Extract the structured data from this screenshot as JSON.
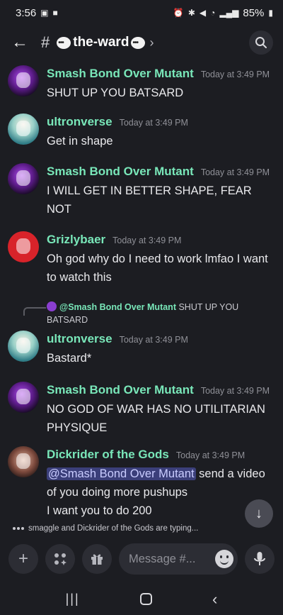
{
  "status_bar": {
    "time": "3:56",
    "battery": "85%"
  },
  "header": {
    "hash": "#",
    "channel_name": "the-ward"
  },
  "messages": [
    {
      "author": "Smash Bond Over Mutant",
      "time": "Today at 3:49 PM",
      "text": "SHUT UP YOU BATSARD"
    },
    {
      "author": "ultronverse",
      "time": "Today at 3:49 PM",
      "text": "Get in shape"
    },
    {
      "author": "Smash Bond Over Mutant",
      "time": "Today at 3:49 PM",
      "text": "I WILL GET IN BETTER SHAPE, FEAR NOT"
    },
    {
      "author": "Grizlybaer",
      "time": "Today at 3:49 PM",
      "text": "Oh god why do I need to work lmfao I want to watch this"
    },
    {
      "author": "ultronverse",
      "time": "Today at 3:49 PM",
      "text": "Bastard*"
    },
    {
      "author": "Smash Bond Over Mutant",
      "time": "Today at 3:49 PM",
      "text": "NO GOD OF WAR HAS NO UTILITARIAN PHYSIQUE"
    },
    {
      "author": "Dickrider of the Gods",
      "time": "Today at 3:49 PM",
      "mention": "@Smash Bond Over Mutant",
      "text": " send a video of you doing more pushups",
      "text2": "I want you to do 200"
    }
  ],
  "reply_ref": {
    "name": "@Smash Bond Over Mutant",
    "text": " SHUT UP YOU BATSARD"
  },
  "typing": "smaggle and Dickrider of the Gods are typing...",
  "composer": {
    "placeholder": "Message #..."
  },
  "icons": {
    "back": "back-arrow-icon",
    "search": "search-icon",
    "plus": "plus-icon",
    "apps": "apps-icon",
    "gift": "gift-icon",
    "emoji": "emoji-icon",
    "mic": "mic-icon",
    "jump": "arrow-down-icon"
  }
}
